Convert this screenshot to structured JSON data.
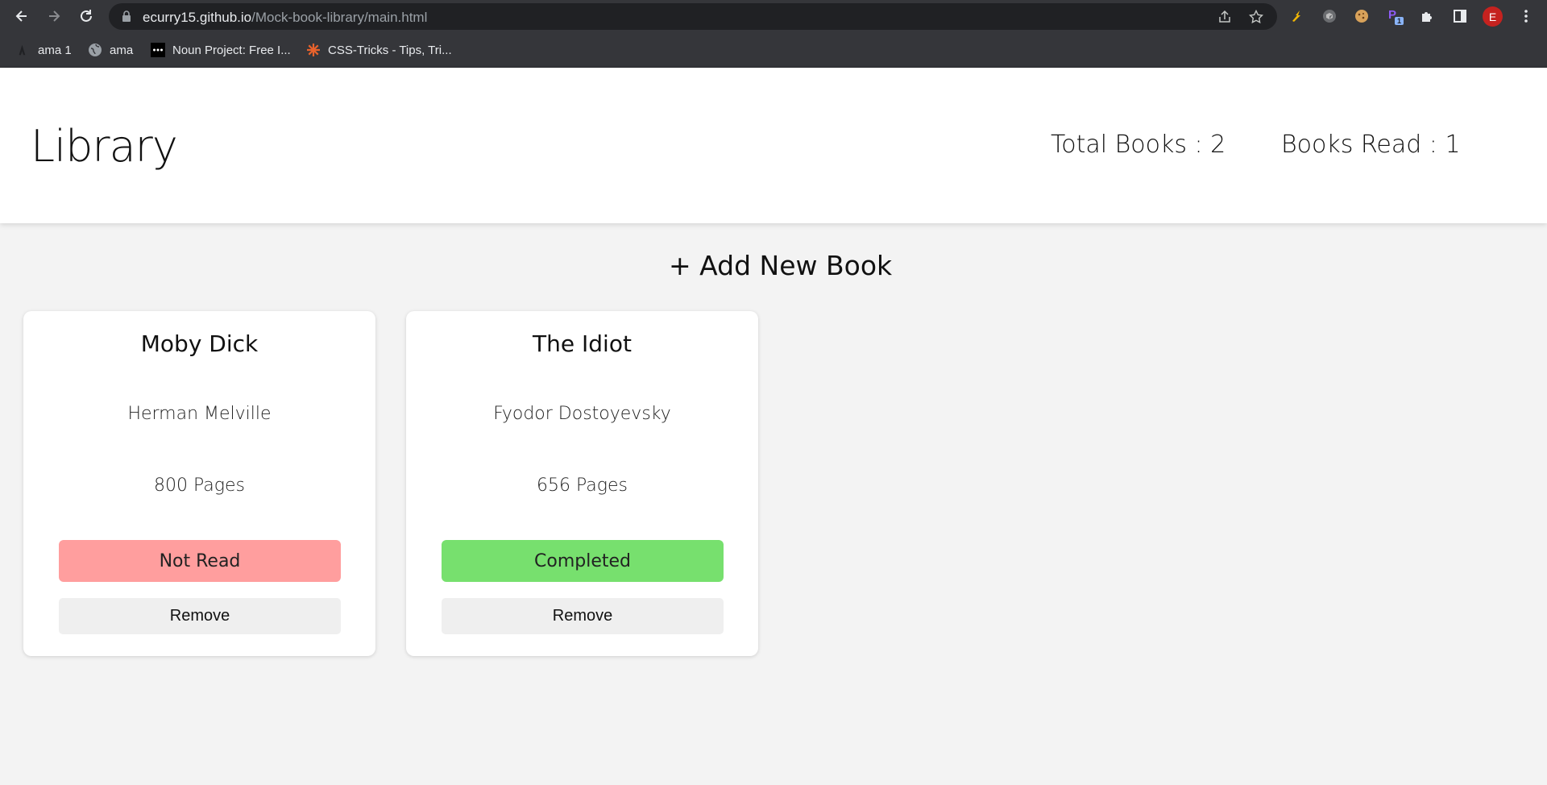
{
  "browser": {
    "url_host": "ecurry15.github.io",
    "url_path": "/Mock-book-library/main.html",
    "profile_initial": "E",
    "extension_badge": "1"
  },
  "bookmarks": [
    {
      "label": "ama 1",
      "icon": "ama-icon"
    },
    {
      "label": "ama",
      "icon": "globe-icon"
    },
    {
      "label": "Noun Project: Free I...",
      "icon": "noun-project-icon"
    },
    {
      "label": "CSS-Tricks - Tips, Tri...",
      "icon": "css-tricks-icon"
    }
  ],
  "header": {
    "title": "Library",
    "total_books": "Total Books : 2",
    "books_read": "Books Read : 1"
  },
  "add_button_label": "+ Add New Book",
  "books": [
    {
      "title": "Moby Dick",
      "author": "Herman Melville",
      "pages": "800 Pages",
      "status": "Not Read",
      "status_color": "#ff9e9e",
      "remove_label": "Remove"
    },
    {
      "title": "The Idiot",
      "author": "Fyodor Dostoyevsky",
      "pages": "656 Pages",
      "status": "Completed",
      "status_color": "#77e06e",
      "remove_label": "Remove"
    }
  ],
  "colors": {
    "chrome_bg": "#35363a",
    "omnibox_bg": "#202124",
    "page_bg": "#f3f3f3",
    "header_bg": "#ffffff",
    "not_read": "#ff9e9e",
    "completed": "#77e06e",
    "remove_bg": "#efefef"
  }
}
